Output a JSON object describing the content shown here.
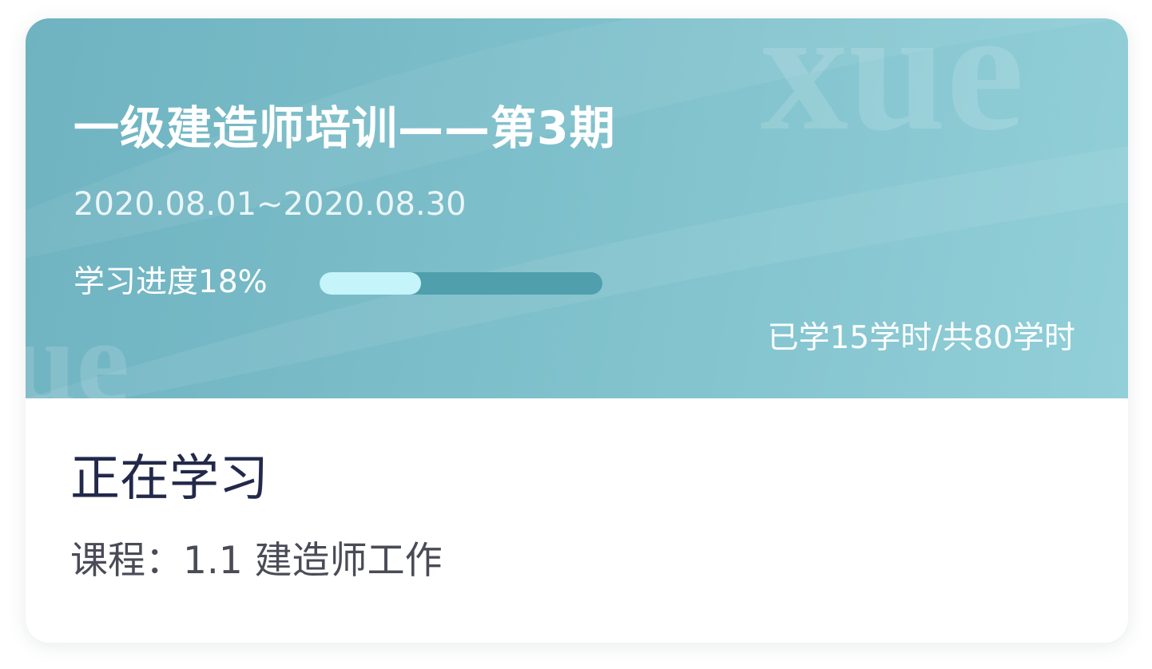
{
  "course": {
    "title": "一级建造师培训——第3期",
    "dates": "2020.08.01~2020.08.30",
    "progress_label": "学习进度18%",
    "progress_percent": 18,
    "hours_text": "已学15学时/共80学时"
  },
  "current": {
    "heading": "正在学习",
    "lesson": "课程：1.1 建造师工作"
  },
  "colors": {
    "banner": "#7dbfca",
    "progress_track": "#4f9fad",
    "progress_fill": "#c5f4fb",
    "heading_text": "#23294a"
  },
  "icons": {
    "watermark": "xue-watermark-graphic"
  }
}
